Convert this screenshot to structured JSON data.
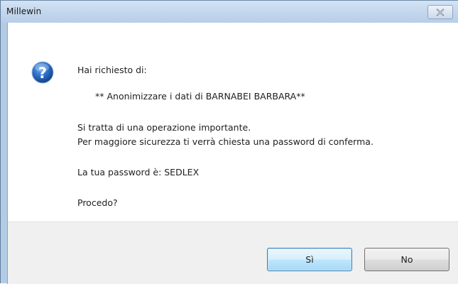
{
  "window": {
    "title": "Millewin",
    "close_icon": "close-icon"
  },
  "dialog": {
    "icon": "question-icon",
    "lines": [
      "Hai richiesto di:",
      "** Anonimizzare i dati di BARNABEI BARBARA**",
      "Si tratta di una operazione importante.",
      "Per maggiore sicurezza ti verrà chiesta una password di conferma.",
      "La tua password è:  SEDLEX",
      "Procedo?"
    ]
  },
  "buttons": {
    "yes_label": "Sì",
    "no_label": "No"
  },
  "colors": {
    "titlebar": "#c5d8ee",
    "button_bar": "#f0f0f0",
    "question_icon_blue": "#1f5fb0",
    "default_button_border": "#3c7fb1"
  }
}
